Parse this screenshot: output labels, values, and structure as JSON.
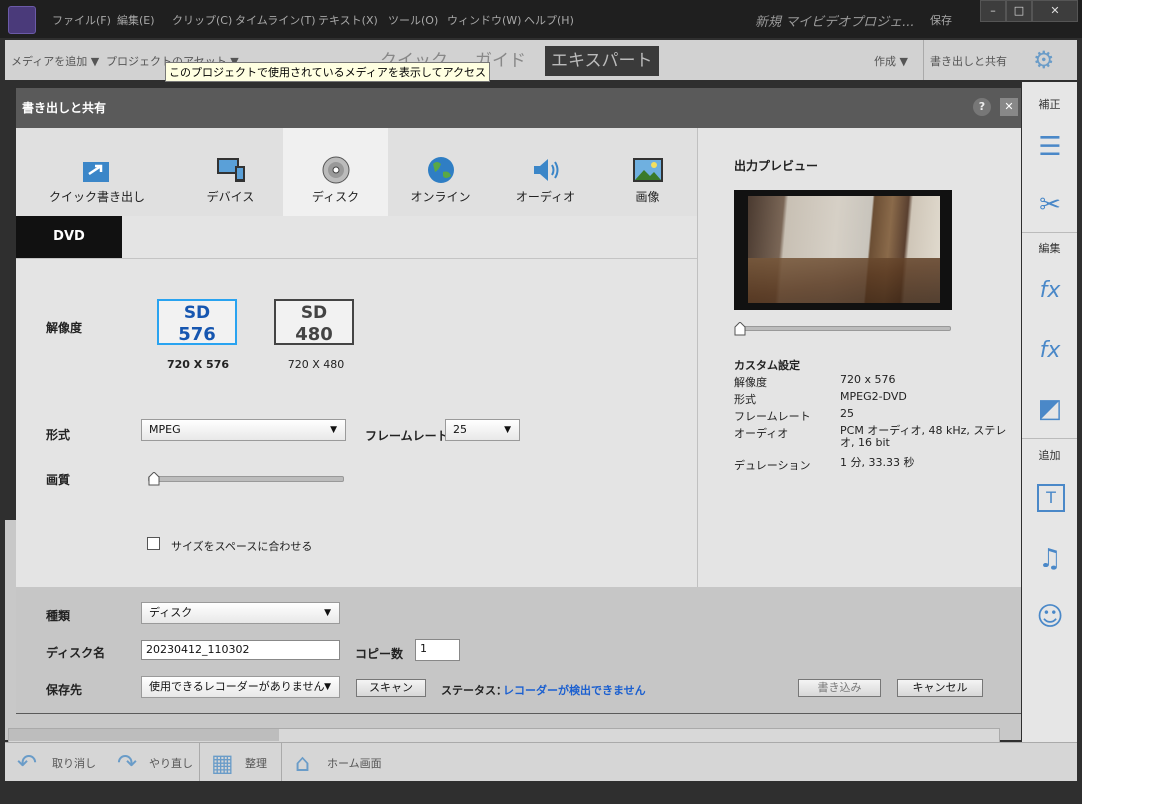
{
  "menubar": {
    "items": [
      "ファイル(F)",
      "編集(E)",
      "クリップ(C)",
      "タイムライン(T)",
      "テキスト(X)",
      "ツール(O)",
      "ウィンドウ(W)",
      "ヘルプ(H)"
    ],
    "project_title": "新規 マイビデオプロジェ...",
    "save_label": "保存"
  },
  "toolbar": {
    "add_media": "メディアを追加",
    "project_assets": "プロジェクトのアセット",
    "modes": [
      "クイック",
      "ガイド",
      "エキスパート"
    ],
    "active_mode": "エキスパート",
    "create": "作成",
    "export_share": "書き出しと共有"
  },
  "tooltip": "このプロジェクトで使用されているメディアを表示してアクセス",
  "right_panel": {
    "adjust_label": "補正",
    "edit_label": "編集",
    "add_label": "追加"
  },
  "bottombar": {
    "undo": "取り消し",
    "redo": "やり直し",
    "organize": "整理",
    "home": "ホーム画面"
  },
  "dialog": {
    "title": "書き出しと共有",
    "help_icon": "?",
    "close_icon": "✕",
    "tabs": [
      {
        "label": "クイック書き出し",
        "icon": "quick-export-icon"
      },
      {
        "label": "デバイス",
        "icon": "device-icon"
      },
      {
        "label": "ディスク",
        "icon": "disc-icon"
      },
      {
        "label": "オンライン",
        "icon": "globe-icon"
      },
      {
        "label": "オーディオ",
        "icon": "speaker-icon"
      },
      {
        "label": "画像",
        "icon": "image-icon"
      }
    ],
    "active_tab": "ディスク",
    "subtab": "DVD",
    "resolution_label": "解像度",
    "resolution_options": [
      {
        "line1": "SD",
        "line2": "576",
        "caption": "720 X 576",
        "selected": true
      },
      {
        "line1": "SD",
        "line2": "480",
        "caption": "720 X 480",
        "selected": false
      }
    ],
    "format_label": "形式",
    "format_value": "MPEG",
    "framerate_label": "フレームレート",
    "framerate_value": "25",
    "quality_label": "画質",
    "quality_level": 0,
    "fit_checkbox_label": "サイズをスペースに合わせる",
    "fit_checked": false,
    "preview_title": "出力プレビュー",
    "preview_position": 0,
    "custom_settings_title": "カスタム設定",
    "settings": [
      {
        "key": "解像度",
        "value": "720 x 576"
      },
      {
        "key": "形式",
        "value": "MPEG2-DVD"
      },
      {
        "key": "フレームレート",
        "value": "25"
      },
      {
        "key": "オーディオ",
        "value": "PCM オーディオ, 48 kHz, ステレオ, 16 bit"
      },
      {
        "key": "デュレーション",
        "value": "1 分, 33.33 秒"
      }
    ],
    "type_label": "種類",
    "type_value": "ディスク",
    "disc_name_label": "ディスク名",
    "disc_name_value": "20230412_110302",
    "copies_label": "コピー数",
    "copies_value": "1",
    "destination_label": "保存先",
    "destination_value": "使用できるレコーダーがありません",
    "scan_button": "スキャン",
    "status_label": "ステータス：",
    "status_value": "レコーダーが検出できません",
    "status_color": "#1a5fd0",
    "burn_button": "書き込み",
    "cancel_button": "キャンセル"
  }
}
